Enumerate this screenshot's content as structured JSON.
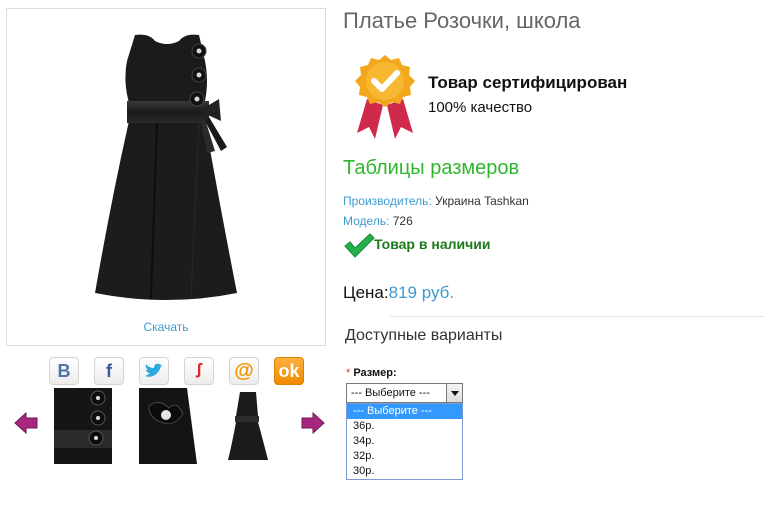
{
  "product": {
    "title": "Платье Розочки, школа",
    "download_label": "Скачать"
  },
  "certificate": {
    "label": "Товар сертифицирован",
    "quality": "100% качество"
  },
  "size_tables_link": "Таблицы размеров",
  "details": {
    "manufacturer_key": "Производитель:",
    "manufacturer_value": "Украина Tashkan",
    "model_key": "Модель:",
    "model_value": "726",
    "stock": "Товар в наличии"
  },
  "price": {
    "label": "Цена:",
    "value": "819 руб."
  },
  "variants": {
    "title": "Доступные варианты",
    "required_mark": "*",
    "size_label": "Размер:",
    "selected": "--- Выберите ---",
    "options": [
      "--- Выберите ---",
      "36р.",
      "34р.",
      "32р.",
      "30р."
    ]
  },
  "social": [
    "vk-icon",
    "facebook-icon",
    "twitter-icon",
    "odnoklassniki-icon",
    "mail-icon",
    "ok-icon"
  ],
  "colors": {
    "link_blue": "#3c9bd0",
    "green": "#2db72d",
    "arrow_purple": "#a8267e"
  }
}
